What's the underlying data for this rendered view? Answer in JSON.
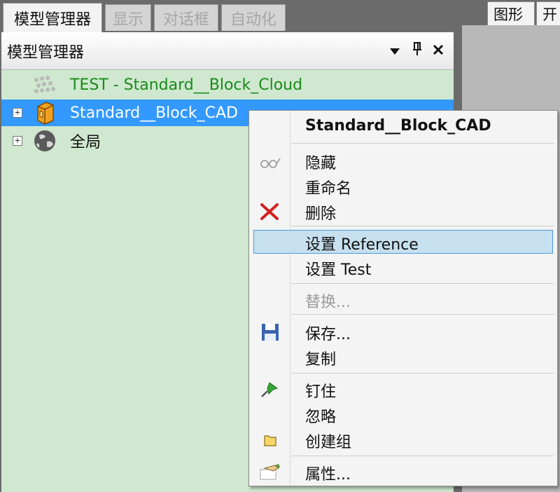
{
  "top_tabs": [
    {
      "label": "模型管理器",
      "active": true
    },
    {
      "label": "显示",
      "active": false
    },
    {
      "label": "对话框",
      "active": false
    },
    {
      "label": "自动化",
      "active": false
    }
  ],
  "right_tabs": [
    {
      "label": "图形"
    },
    {
      "label": "开"
    }
  ],
  "panel": {
    "title": "模型管理器",
    "dropdown_icon": "dropdown-arrow-icon",
    "pin_icon": "pin-icon",
    "close_icon": "close-icon"
  },
  "tree": [
    {
      "label": "TEST - Standard__Block_Cloud",
      "icon": "point-cloud-icon",
      "expander": "",
      "color": "#1a8a1a",
      "selected": false
    },
    {
      "label": "Standard__Block_CAD",
      "icon": "cad-block-icon",
      "expander": "+",
      "color": "#ffffff",
      "selected": true
    },
    {
      "label": "全局",
      "icon": "globe-icon",
      "expander": "+",
      "color": "#111111",
      "selected": false
    }
  ],
  "context_menu": {
    "header": "Standard__Block_CAD",
    "items": {
      "hide": "隐藏",
      "rename": "重命名",
      "delete": "删除",
      "set_reference": "设置 Reference",
      "set_test": "设置 Test",
      "replace": "替换...",
      "save": "保存...",
      "copy": "复制",
      "pin": "钉住",
      "ignore": "忽略",
      "create_group": "创建组",
      "properties": "属性..."
    }
  },
  "colors": {
    "panel_bg": "#cfe8cf",
    "selection": "#3399ff",
    "menu_hover": "#c6e0ef",
    "menu_hover_border": "#4c9ad6"
  }
}
